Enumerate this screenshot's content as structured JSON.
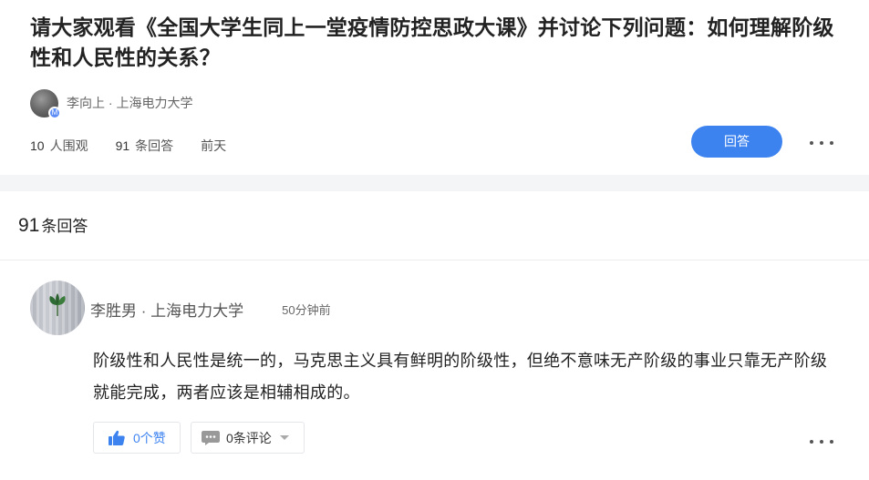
{
  "question": {
    "title": "请大家观看《全国大学生同上一堂疫情防控思政大课》并讨论下列问题：如何理解阶级性和人民性的关系？",
    "asker": "李向上 · 上海电力大学",
    "views_num": "10",
    "views_label": "人围观",
    "answers_num": "91",
    "answers_label": "条回答",
    "time": "前天",
    "answer_button": "回答"
  },
  "answers_header": {
    "count": "91",
    "label": "条回答"
  },
  "answer": {
    "author": "李胜男 · 上海电力大学",
    "time": "50分钟前",
    "content": "阶级性和人民性是统一的，马克思主义具有鲜明的阶级性，但绝不意味无产阶级的事业只靠无产阶级就能完成，两者应该是相辅相成的。",
    "likes_label": "0个赞",
    "comments_label": "0条评论"
  },
  "colors": {
    "accent": "#3d83f0",
    "divider_band": "#f4f5f7",
    "border": "#e5e6ea"
  },
  "icons": [
    "avatar-badge-icon",
    "thumbs-up-icon",
    "comment-icon",
    "caret-down-icon",
    "more-dots-icon",
    "leaf-icon"
  ]
}
